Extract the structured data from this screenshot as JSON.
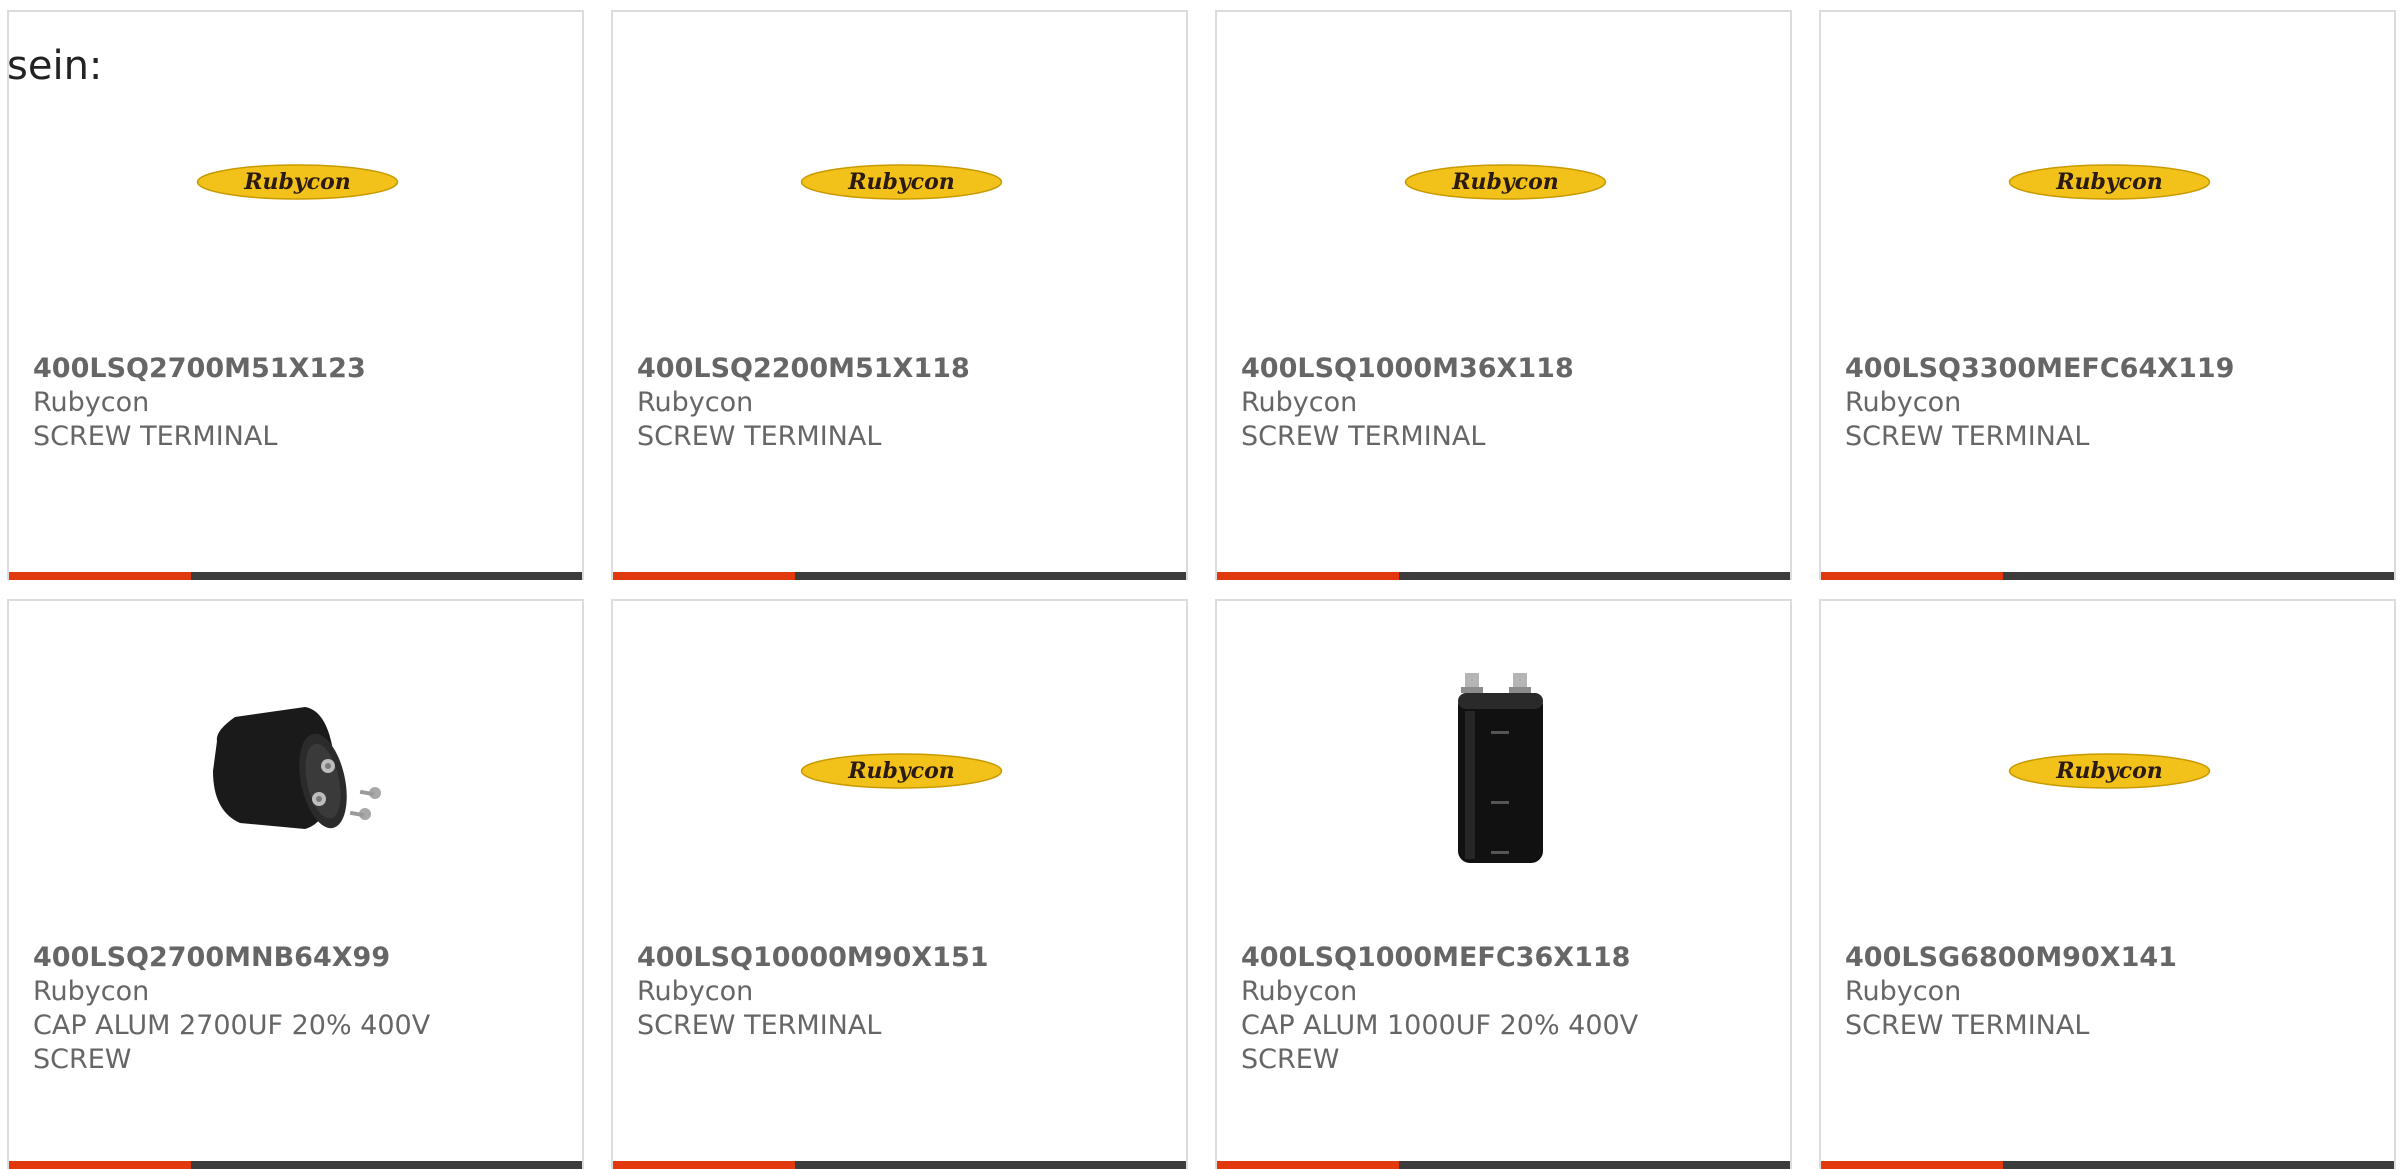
{
  "lead_text": "sein:",
  "colors": {
    "accent": "#e2380e",
    "bar": "#3c3c3c",
    "border": "#dcdcdc",
    "text": "#666666",
    "logo_yellow": "#f2c21b",
    "logo_text": "#2a1a10"
  },
  "products": [
    {
      "part": "400LSQ2700M51X123",
      "manufacturer": "Rubycon",
      "description": "SCREW TERMINAL",
      "image": "rubycon-logo",
      "logo_text": "Rubycon"
    },
    {
      "part": "400LSQ2200M51X118",
      "manufacturer": "Rubycon",
      "description": "SCREW TERMINAL",
      "image": "rubycon-logo",
      "logo_text": "Rubycon"
    },
    {
      "part": "400LSQ1000M36X118",
      "manufacturer": "Rubycon",
      "description": "SCREW TERMINAL",
      "image": "rubycon-logo",
      "logo_text": "Rubycon"
    },
    {
      "part": "400LSQ3300MEFC64X119",
      "manufacturer": "Rubycon",
      "description": "SCREW TERMINAL",
      "image": "rubycon-logo",
      "logo_text": "Rubycon"
    },
    {
      "part": "400LSQ2700MNB64X99",
      "manufacturer": "Rubycon",
      "description": "CAP ALUM 2700UF 20% 400V SCREW",
      "image": "capacitor-horizontal"
    },
    {
      "part": "400LSQ10000M90X151",
      "manufacturer": "Rubycon",
      "description": "SCREW TERMINAL",
      "image": "rubycon-logo",
      "logo_text": "Rubycon"
    },
    {
      "part": "400LSQ1000MEFC36X118",
      "manufacturer": "Rubycon",
      "description": "CAP ALUM 1000UF 20% 400V SCREW",
      "image": "capacitor-vertical"
    },
    {
      "part": "400LSG6800M90X141",
      "manufacturer": "Rubycon",
      "description": "SCREW TERMINAL",
      "image": "rubycon-logo",
      "logo_text": "Rubycon"
    }
  ]
}
